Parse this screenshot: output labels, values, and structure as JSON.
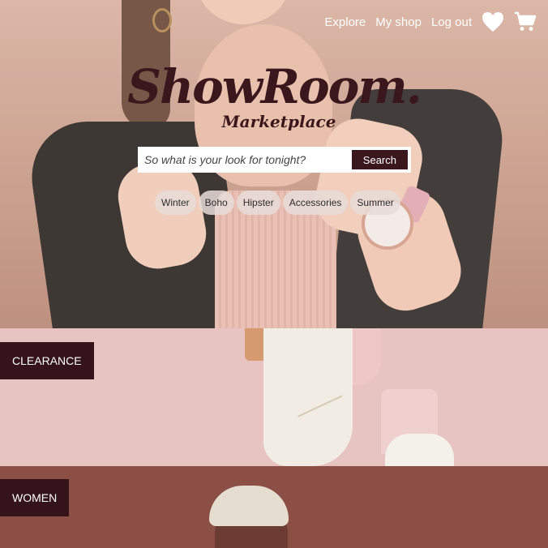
{
  "nav": {
    "links": [
      "Explore",
      "My shop",
      "Log out"
    ],
    "icons": [
      "heart-icon",
      "cart-icon"
    ]
  },
  "logo": {
    "brand": "ShowRoom.",
    "subtitle": "Marketplace"
  },
  "search": {
    "placeholder": "So what is your look for tonight?",
    "button_label": "Search"
  },
  "tags": [
    "Winter",
    "Boho",
    "Hipster",
    "Accessories",
    "Summer"
  ],
  "categories": [
    {
      "label": "CLEARANCE"
    },
    {
      "label": "WOMEN"
    }
  ],
  "colors": {
    "brand_dark": "#3a171c",
    "label_bg": "#34141a",
    "clearance_bg": "#e7c3c2",
    "women_bg": "#8b4f45"
  }
}
